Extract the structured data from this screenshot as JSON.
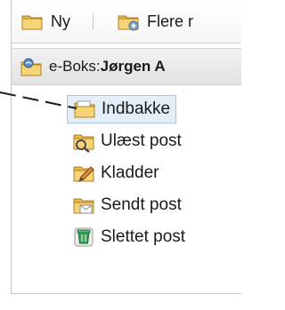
{
  "toolbar": {
    "new_label": "Ny",
    "more_label": "Flere r"
  },
  "account": {
    "prefix": "e-Boks: ",
    "name": "Jørgen A"
  },
  "folders": [
    {
      "label": "Indbakke",
      "icon": "inbox-folder-icon",
      "selected": true
    },
    {
      "label": "Ulæst post",
      "icon": "unread-mail-folder-icon",
      "selected": false
    },
    {
      "label": "Kladder",
      "icon": "drafts-folder-icon",
      "selected": false
    },
    {
      "label": "Sendt post",
      "icon": "sent-mail-folder-icon",
      "selected": false
    },
    {
      "label": "Slettet post",
      "icon": "trash-folder-icon",
      "selected": false
    }
  ],
  "colors": {
    "selection_bg": "#e3eef9",
    "selection_border": "#a9c6e6",
    "folder_yellow": "#f2c94c",
    "trash_green": "#3aa15a"
  }
}
